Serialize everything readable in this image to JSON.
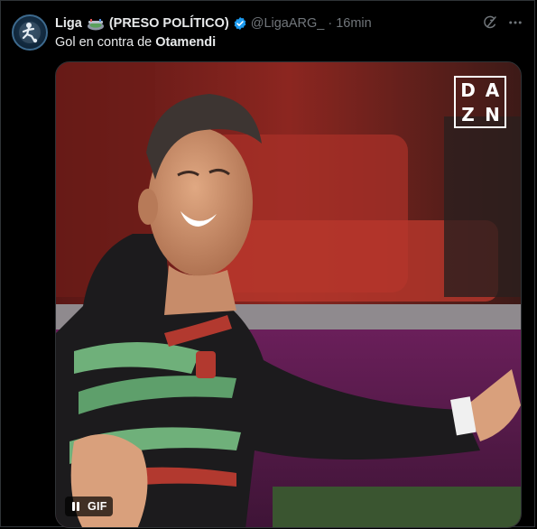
{
  "tweet": {
    "display_name": "Liga",
    "name_emoji_icon": "stadium-icon",
    "name_suffix": "(PRESO POLÍTICO)",
    "verified_icon": "verified-badge-icon",
    "handle": "@LigaARG_",
    "separator": "·",
    "time": "16min",
    "text_prefix": "Gol en contra de ",
    "text_bold": "Otamendi"
  },
  "media": {
    "watermark_letters": [
      "D",
      "A",
      "Z",
      "N"
    ],
    "gif_label": "GIF",
    "pause_icon": "pause-icon"
  },
  "colors": {
    "background": "#000000",
    "text": "#e7e9ea",
    "muted": "#71767b",
    "verified_blue": "#1d9bf0",
    "border": "#2f3336"
  }
}
